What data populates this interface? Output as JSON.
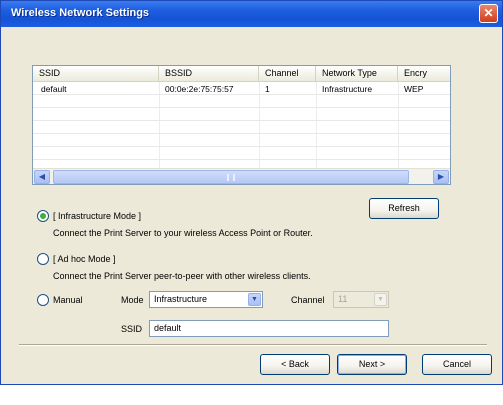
{
  "window": {
    "title": "Wireless Network Settings",
    "close_glyph": "✕"
  },
  "network_list": {
    "columns": [
      "SSID",
      "BSSID",
      "Channel",
      "Network Type",
      "Encry"
    ],
    "rows": [
      [
        "default",
        "00:0e:2e:75:75:57",
        "1",
        "Infrastructure",
        "WEP"
      ]
    ]
  },
  "scrollbar": {
    "left_glyph": "◀",
    "right_glyph": "▶"
  },
  "refresh_button": {
    "label": "Refresh"
  },
  "modes": {
    "infrastructure": {
      "label": "[ Infrastructure Mode ]",
      "description": "Connect the Print Server to your wireless Access Point or Router.",
      "selected": true
    },
    "adhoc": {
      "label": "[ Ad hoc Mode ]",
      "description": "Connect the Print Server peer-to-peer with other wireless clients.",
      "selected": false
    },
    "manual": {
      "label": "Manual",
      "selected": false,
      "mode_label": "Mode",
      "mode_value": "Infrastructure",
      "channel_label": "Channel",
      "channel_value": "11",
      "ssid_label": "SSID",
      "ssid_value": "default"
    }
  },
  "dropdown_glyph": "▼",
  "footer": {
    "back_label": "< Back",
    "next_label": "Next >",
    "cancel_label": "Cancel"
  }
}
